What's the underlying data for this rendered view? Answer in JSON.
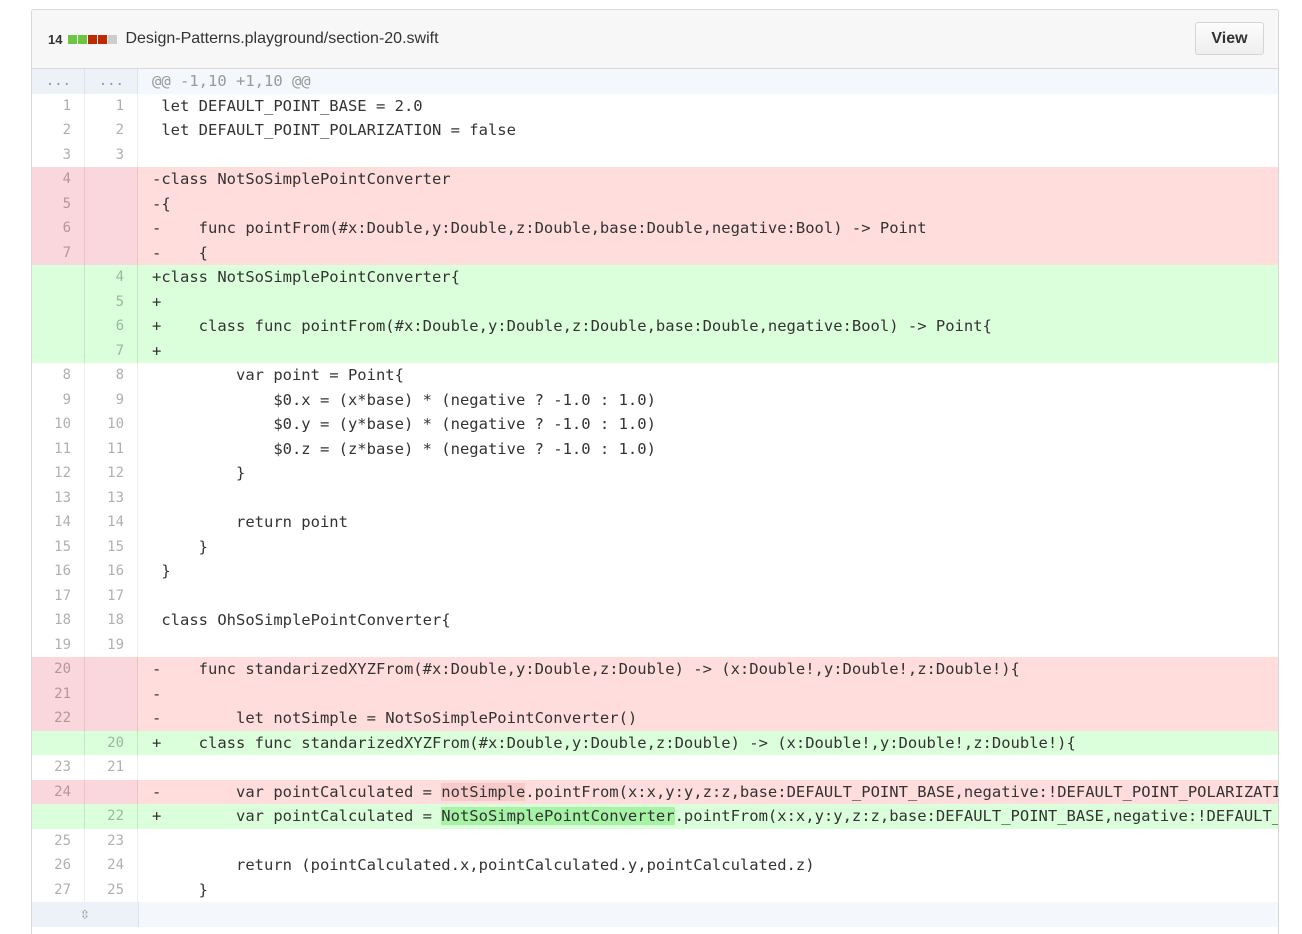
{
  "file": {
    "change_count": "14",
    "diffstat_colors": [
      "#6cc644",
      "#6cc644",
      "#bd2c00",
      "#bd2c00",
      "#cccccc"
    ],
    "path": "Design-Patterns.playground/section-20.swift",
    "view_label": "View"
  },
  "expand_icon": "unfold-icon",
  "lines": [
    {
      "type": "hunk",
      "old": "...",
      "new": "...",
      "text": "@@ -1,10 +1,10 @@"
    },
    {
      "type": "ctx",
      "old": "1",
      "new": "1",
      "text": " let DEFAULT_POINT_BASE = 2.0"
    },
    {
      "type": "ctx",
      "old": "2",
      "new": "2",
      "text": " let DEFAULT_POINT_POLARIZATION = false"
    },
    {
      "type": "ctx",
      "old": "3",
      "new": "3",
      "text": " "
    },
    {
      "type": "del",
      "old": "4",
      "new": "",
      "text": "-class NotSoSimplePointConverter"
    },
    {
      "type": "del",
      "old": "5",
      "new": "",
      "text": "-{"
    },
    {
      "type": "del",
      "old": "6",
      "new": "",
      "text": "-    func pointFrom(#x:Double,y:Double,z:Double,base:Double,negative:Bool) -> Point"
    },
    {
      "type": "del",
      "old": "7",
      "new": "",
      "text": "-    {"
    },
    {
      "type": "add",
      "old": "",
      "new": "4",
      "text": "+class NotSoSimplePointConverter{"
    },
    {
      "type": "add",
      "old": "",
      "new": "5",
      "text": "+"
    },
    {
      "type": "add",
      "old": "",
      "new": "6",
      "text": "+    class func pointFrom(#x:Double,y:Double,z:Double,base:Double,negative:Bool) -> Point{"
    },
    {
      "type": "add",
      "old": "",
      "new": "7",
      "text": "+"
    },
    {
      "type": "ctx",
      "old": "8",
      "new": "8",
      "text": "         var point = Point{"
    },
    {
      "type": "ctx",
      "old": "9",
      "new": "9",
      "text": "             $0.x = (x*base) * (negative ? -1.0 : 1.0)"
    },
    {
      "type": "ctx",
      "old": "10",
      "new": "10",
      "text": "             $0.y = (y*base) * (negative ? -1.0 : 1.0)"
    },
    {
      "type": "ctx",
      "old": "11",
      "new": "11",
      "text": "             $0.z = (z*base) * (negative ? -1.0 : 1.0)"
    },
    {
      "type": "ctx",
      "old": "12",
      "new": "12",
      "text": "         }"
    },
    {
      "type": "ctx",
      "old": "13",
      "new": "13",
      "text": " "
    },
    {
      "type": "ctx",
      "old": "14",
      "new": "14",
      "text": "         return point"
    },
    {
      "type": "ctx",
      "old": "15",
      "new": "15",
      "text": "     }"
    },
    {
      "type": "ctx",
      "old": "16",
      "new": "16",
      "text": " }"
    },
    {
      "type": "ctx",
      "old": "17",
      "new": "17",
      "text": " "
    },
    {
      "type": "ctx",
      "old": "18",
      "new": "18",
      "text": " class OhSoSimplePointConverter{"
    },
    {
      "type": "ctx",
      "old": "19",
      "new": "19",
      "text": " "
    },
    {
      "type": "del",
      "old": "20",
      "new": "",
      "text": "-    func standarizedXYZFrom(#x:Double,y:Double,z:Double) -> (x:Double!,y:Double!,z:Double!){"
    },
    {
      "type": "del",
      "old": "21",
      "new": "",
      "text": "-"
    },
    {
      "type": "del",
      "old": "22",
      "new": "",
      "text": "-        let notSimple = NotSoSimplePointConverter()"
    },
    {
      "type": "add",
      "old": "",
      "new": "20",
      "text": "+    class func standarizedXYZFrom(#x:Double,y:Double,z:Double) -> (x:Double!,y:Double!,z:Double!){"
    },
    {
      "type": "ctx",
      "old": "23",
      "new": "21",
      "text": " "
    },
    {
      "type": "del",
      "old": "24",
      "new": "",
      "pre": "-        var pointCalculated = ",
      "hl": "notSimple",
      "post": ".pointFrom(x:x,y:y,z:z,base:DEFAULT_POINT_BASE,negative:!DEFAULT_POINT_POLARIZATION)"
    },
    {
      "type": "add",
      "old": "",
      "new": "22",
      "pre": "+        var pointCalculated = ",
      "hl": "NotSoSimplePointConverter",
      "post": ".pointFrom(x:x,y:y,z:z,base:DEFAULT_POINT_BASE,negative:!DEFAULT_POINT_POLARIZATION)"
    },
    {
      "type": "ctx",
      "old": "25",
      "new": "23",
      "text": " "
    },
    {
      "type": "ctx",
      "old": "26",
      "new": "24",
      "text": "         return (pointCalculated.x,pointCalculated.y,pointCalculated.z)"
    },
    {
      "type": "ctx",
      "old": "27",
      "new": "25",
      "text": "     }"
    }
  ]
}
